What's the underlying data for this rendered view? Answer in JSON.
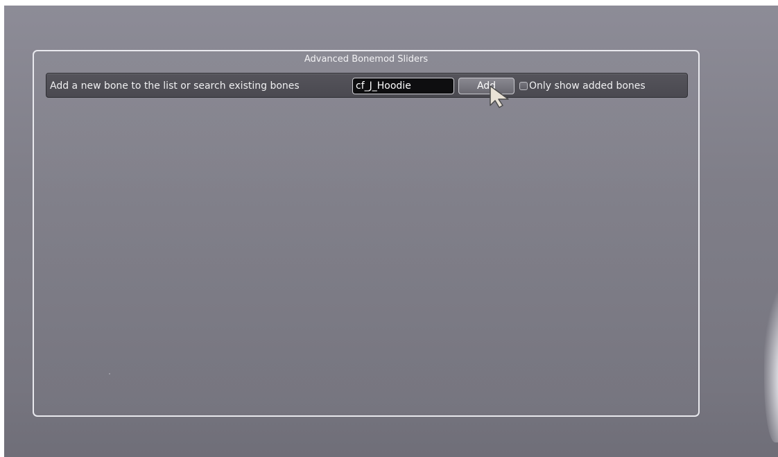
{
  "window": {
    "title": "Advanced Bonemod Sliders"
  },
  "toolbar": {
    "label": "Add a new bone to the list or search existing bones",
    "search_value": "cf_J_Hoodie",
    "add_label": "Add",
    "checkbox_label": "Only show added bones",
    "checkbox_checked": false
  },
  "icons": {
    "cursor": "mouse-pointer-icon",
    "checkbox": "checkbox-icon"
  },
  "colors": {
    "panel_border": "#e9e9ee",
    "toolbar_bg": "#4e4d54",
    "input_bg": "#0e0e10",
    "text": "#f0f0f2"
  }
}
